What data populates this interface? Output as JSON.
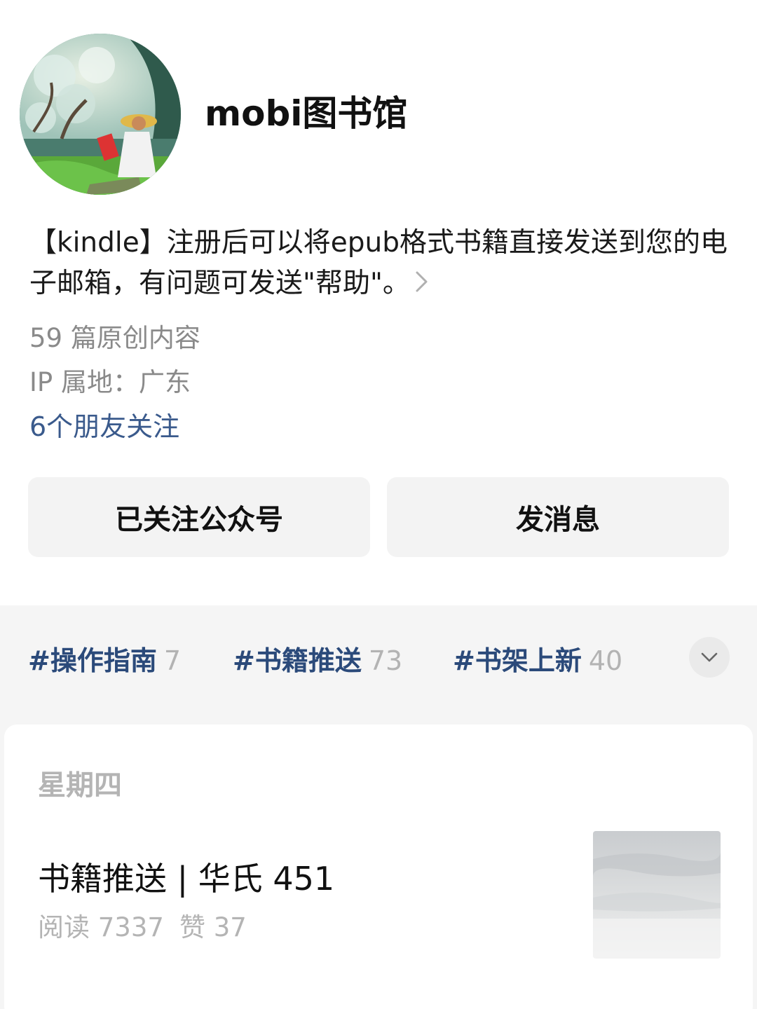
{
  "profile": {
    "name": "mobi图书馆",
    "description": "【kindle】注册后可以将epub格式书籍直接发送到您的电子邮箱，有问题可发送\"帮助\"。",
    "originals": "59 篇原创内容",
    "ip_location": "IP 属地：广东",
    "friends_follow": "6个朋友关注"
  },
  "actions": {
    "follow_label": "已关注公众号",
    "message_label": "发消息"
  },
  "topics": [
    {
      "tag": "#操作指南",
      "count": "7"
    },
    {
      "tag": "#书籍推送",
      "count": "73"
    },
    {
      "tag": "#书架上新",
      "count": "40"
    }
  ],
  "feed": {
    "day_label": "星期四",
    "articles": [
      {
        "title": "书籍推送 | 华氏 451",
        "reads": "阅读 7337",
        "likes": "赞 37"
      }
    ]
  },
  "icons": {
    "description_more": "chevron-right-icon",
    "topics_expand": "chevron-down-icon"
  },
  "colors": {
    "link_blue": "#3a5a8c",
    "topic_blue": "#2b4a7a",
    "muted_gray": "#8a8a8a",
    "button_bg": "#f3f3f3",
    "strip_bg": "#f5f5f5"
  }
}
